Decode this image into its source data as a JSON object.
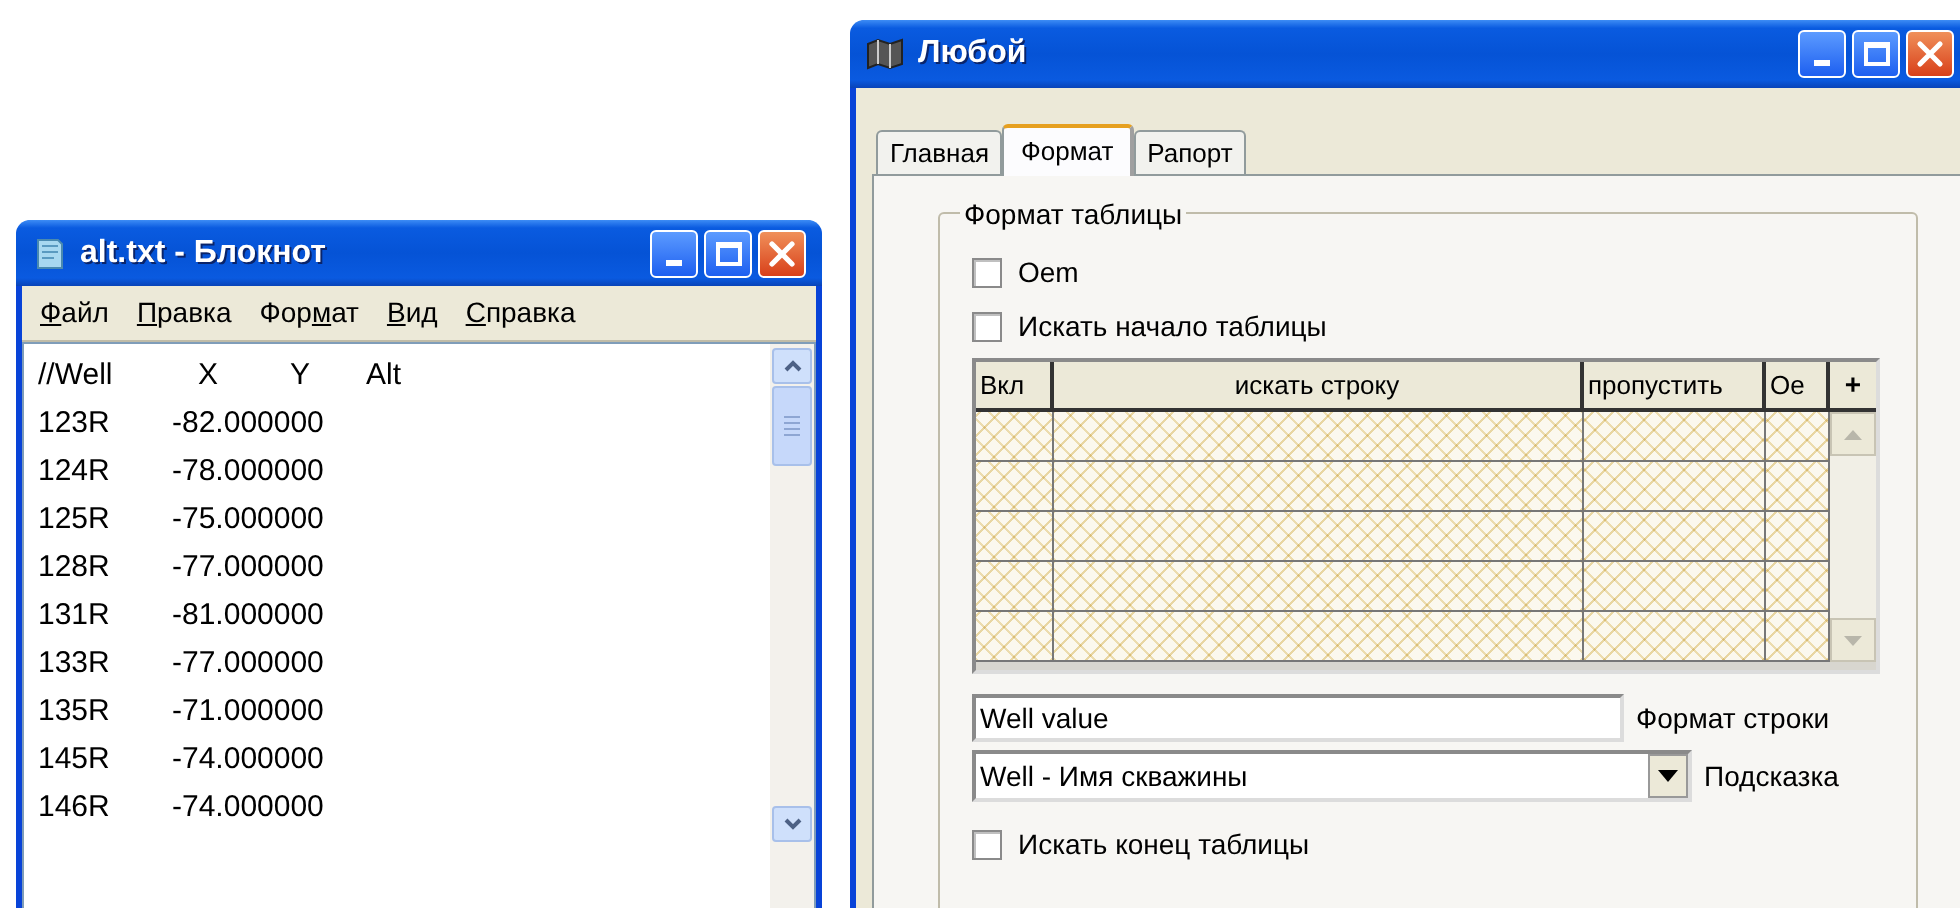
{
  "notepad": {
    "title": "alt.txt - Блокнот",
    "menu": [
      {
        "key": "Ф",
        "rest": "айл"
      },
      {
        "key": "П",
        "rest": "равка"
      },
      {
        "key": "м",
        "rest_before": "Фор",
        "rest": "ат"
      },
      {
        "key": "В",
        "rest": "ид"
      },
      {
        "key": "С",
        "rest": "правка"
      }
    ],
    "lines": [
      {
        "kind": "header",
        "cells": [
          "//Well",
          "X",
          "Y",
          "Alt"
        ]
      },
      {
        "kind": "data",
        "cells": [
          "123R",
          "-82.000000"
        ]
      },
      {
        "kind": "data",
        "cells": [
          "124R",
          "-78.000000"
        ]
      },
      {
        "kind": "data",
        "cells": [
          "125R",
          "-75.000000"
        ]
      },
      {
        "kind": "data",
        "cells": [
          "128R",
          "-77.000000"
        ]
      },
      {
        "kind": "data",
        "cells": [
          "131R",
          "-81.000000"
        ]
      },
      {
        "kind": "data",
        "cells": [
          "133R",
          "-77.000000"
        ]
      },
      {
        "kind": "data",
        "cells": [
          "135R",
          "-71.000000"
        ]
      },
      {
        "kind": "data",
        "cells": [
          "145R",
          "-74.000000"
        ]
      },
      {
        "kind": "data",
        "cells": [
          "146R",
          "-74.000000"
        ]
      }
    ]
  },
  "dialog": {
    "title": "Любой",
    "tabs": [
      {
        "label": "Главная",
        "selected": false
      },
      {
        "label": "Формат",
        "selected": true
      },
      {
        "label": "Рапорт",
        "selected": false
      }
    ],
    "group": {
      "title": "Формат таблицы",
      "checkboxes": [
        {
          "label": "Оem",
          "checked": false
        },
        {
          "label": "Искать начало таблицы",
          "checked": false
        }
      ],
      "table": {
        "columns": [
          "Вкл",
          "искать строку",
          "пропустить",
          "Oe"
        ],
        "add_button": "+"
      },
      "format_field": {
        "value": "Well value",
        "label": "Формат строки"
      },
      "hint_select": {
        "value": "Well - Имя скважины",
        "label": "Подсказка"
      },
      "end_checkbox": {
        "label": "Искать конец таблицы",
        "checked": false
      }
    }
  }
}
